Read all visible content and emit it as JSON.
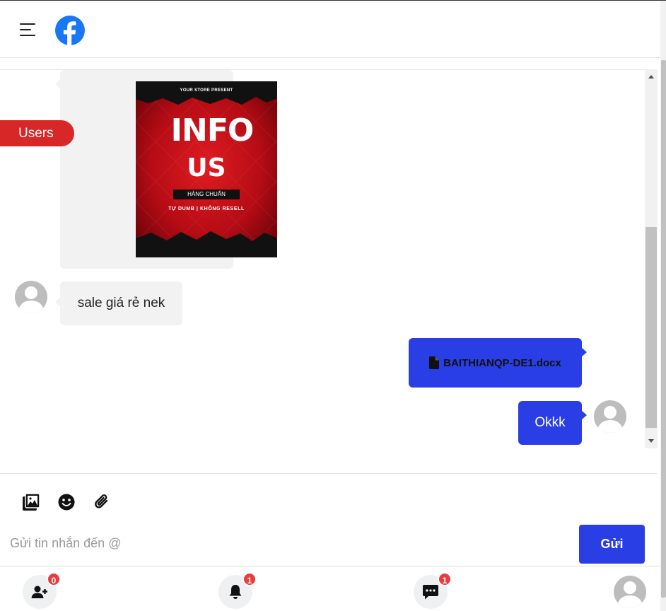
{
  "header": {
    "menu_icon": "hamburger-icon",
    "logo_icon": "facebook-logo-icon",
    "brand_color": "#1877f2"
  },
  "sidebar": {
    "users_label": "Users",
    "users_color": "#d72727"
  },
  "messages": [
    {
      "side": "left",
      "type": "image",
      "poster": {
        "top_text": "YOUR STORE PRESENT",
        "headline": "INFO",
        "subhead": "US",
        "tag": "HÀNG CHUẨN",
        "tagline": "TỰ DUMB | KHÔNG RESELL"
      }
    },
    {
      "side": "left",
      "type": "text",
      "text": "sale giá rẻ nek",
      "avatar_icon": "default-user-avatar-icon"
    },
    {
      "side": "right",
      "type": "file",
      "file_icon": "file-icon",
      "file_name": "BAITHIANQP-DE1.docx"
    },
    {
      "side": "right",
      "type": "text",
      "text": "Okkk",
      "avatar_icon": "default-user-avatar-icon"
    }
  ],
  "composer": {
    "tools": [
      "image-gallery-icon",
      "emoji-icon",
      "paperclip-icon"
    ],
    "placeholder": "Gửi tin nhắn đến @",
    "send_label": "Gửi",
    "send_color": "#2a3ee6"
  },
  "bottom_nav": {
    "friend_requests": {
      "icon": "add-friend-icon",
      "count": "0"
    },
    "notifications": {
      "icon": "bell-icon",
      "count": "1"
    },
    "messages": {
      "icon": "chat-icon",
      "count": "1"
    },
    "profile": {
      "icon": "default-user-avatar-icon"
    }
  }
}
